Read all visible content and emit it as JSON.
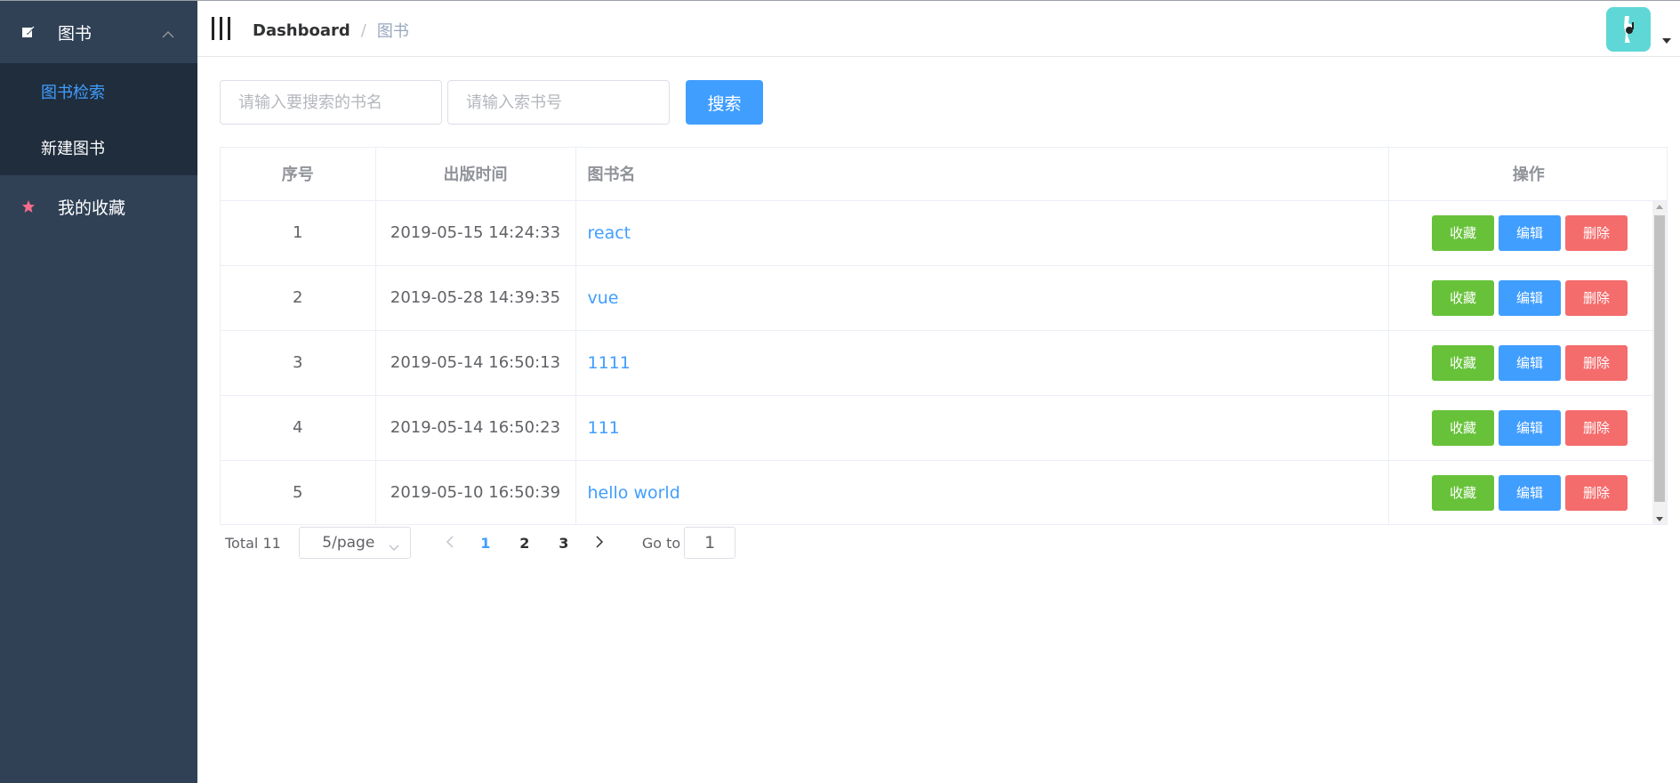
{
  "sidebar": {
    "books_menu": {
      "label": "图书",
      "icon": "edit-icon"
    },
    "items": [
      {
        "label": "图书检索",
        "active": true
      },
      {
        "label": "新建图书",
        "active": false
      }
    ],
    "favorites": {
      "label": "我的收藏",
      "icon": "star-icon"
    }
  },
  "navbar": {
    "breadcrumb_home": "Dashboard",
    "breadcrumb_sep": "/",
    "breadcrumb_current": "图书"
  },
  "search": {
    "name_placeholder": "请输入要搜索的书名",
    "index_placeholder": "请输入索书号",
    "button_label": "搜索"
  },
  "table": {
    "headers": [
      "序号",
      "出版时间",
      "图书名",
      "操作"
    ],
    "rows": [
      {
        "id": "1",
        "date": "2019-05-15 14:24:33",
        "name": "react"
      },
      {
        "id": "2",
        "date": "2019-05-28 14:39:35",
        "name": "vue"
      },
      {
        "id": "3",
        "date": "2019-05-14 16:50:13",
        "name": "1111"
      },
      {
        "id": "4",
        "date": "2019-05-14 16:50:23",
        "name": "111"
      },
      {
        "id": "5",
        "date": "2019-05-10 16:50:39",
        "name": "hello world"
      }
    ],
    "actions": {
      "favorite": "收藏",
      "edit": "编辑",
      "delete": "删除"
    }
  },
  "pagination": {
    "total": "Total 11",
    "page_size": "5/page",
    "pages": [
      "1",
      "2",
      "3"
    ],
    "current_page": "1",
    "goto_label": "Go to",
    "goto_value": "1"
  },
  "colors": {
    "sidebar_bg": "#304156",
    "submenu_bg": "#1f2d3d",
    "primary": "#409eff",
    "success": "#67c23a",
    "danger": "#f56c6c",
    "avatar_bg": "#5fd7d7"
  }
}
